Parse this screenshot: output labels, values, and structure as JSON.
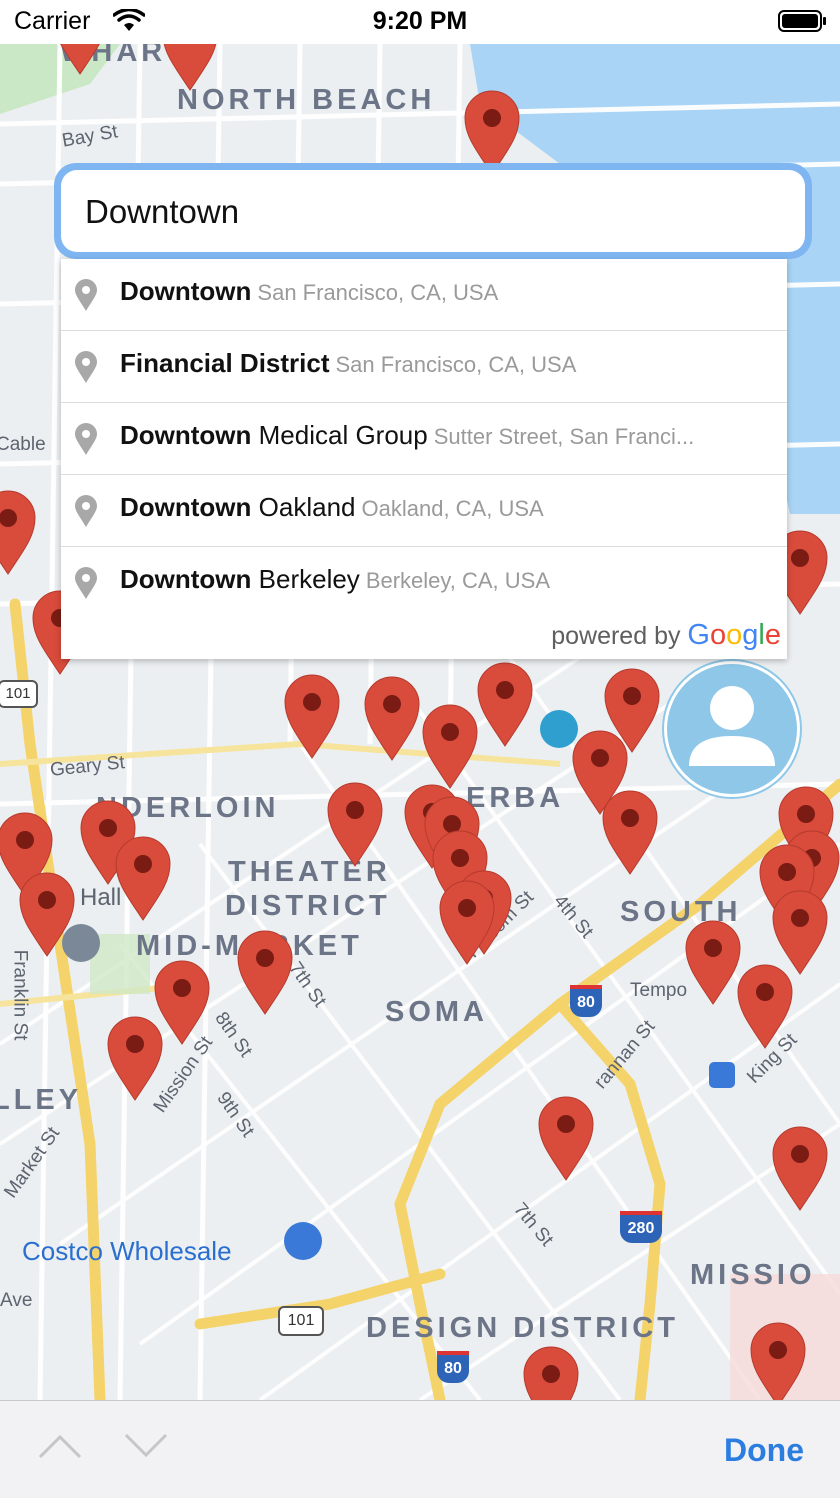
{
  "status_bar": {
    "carrier": "Carrier",
    "time": "9:20 PM"
  },
  "search": {
    "value": "Downtown"
  },
  "suggestions": [
    {
      "main": "Downtown",
      "rest": "",
      "secondary": "San Francisco, CA, USA"
    },
    {
      "main": "Financial District",
      "rest": "",
      "secondary": "San Francisco, CA, USA"
    },
    {
      "main": "Downtown",
      "rest": " Medical Group",
      "secondary": "Sutter Street, San Franci..."
    },
    {
      "main": "Downtown",
      "rest": " Oakland",
      "secondary": "Oakland, CA, USA"
    },
    {
      "main": "Downtown",
      "rest": " Berkeley",
      "secondary": "Berkeley, CA, USA"
    }
  ],
  "attribution": {
    "prefix": "powered by",
    "brand": [
      "G",
      "o",
      "o",
      "g",
      "l",
      "e"
    ]
  },
  "map_labels": {
    "north_beach": "NORTH BEACH",
    "wharf": "WHAR",
    "bay_st": "Bay St",
    "tenderloin": "NDERLOIN",
    "theater_district_1": "THEATER",
    "theater_district_2": "DISTRICT",
    "mid_market": "MID-MARKET",
    "soma": "SOMA",
    "south": "SOUTH",
    "yerba": "ERBA",
    "design_district": "DESIGN DISTRICT",
    "mission": "MISSIO",
    "valley": "LLEY",
    "geary_st": "Geary St",
    "franklin_st": "Franklin St",
    "seventh_st": "7th St",
    "eighth_st": "8th St",
    "ninth_st": "9th St",
    "mission_st": "Mission St",
    "market_st": "Market St",
    "folsom_st": "Folsom St",
    "fourth_st": "4th St",
    "brannan_st": "rannan St",
    "king_st": "King St",
    "seventh_st_2": "7th St",
    "tempo": "Tempo",
    "costco": "Costco Wholesale",
    "hall": "Hall",
    "cable": "Cable",
    "ave": "Ave",
    "hwy_101_a": "101",
    "hwy_101_b": "101",
    "hwy_80_a": "80",
    "hwy_80_b": "80",
    "hwy_280": "280"
  },
  "toolbar": {
    "done_label": "Done"
  },
  "colors": {
    "accent": "#2b7de0",
    "pin": "#d94b3b",
    "pin_dot": "#7a1c14",
    "google": [
      "#4285F4",
      "#EA4335",
      "#FBBC05",
      "#4285F4",
      "#34A853",
      "#EA4335"
    ]
  },
  "icons": {
    "pin": "map-pin-icon",
    "suggestion": "location-pin-icon",
    "avatar": "user-avatar-icon"
  }
}
